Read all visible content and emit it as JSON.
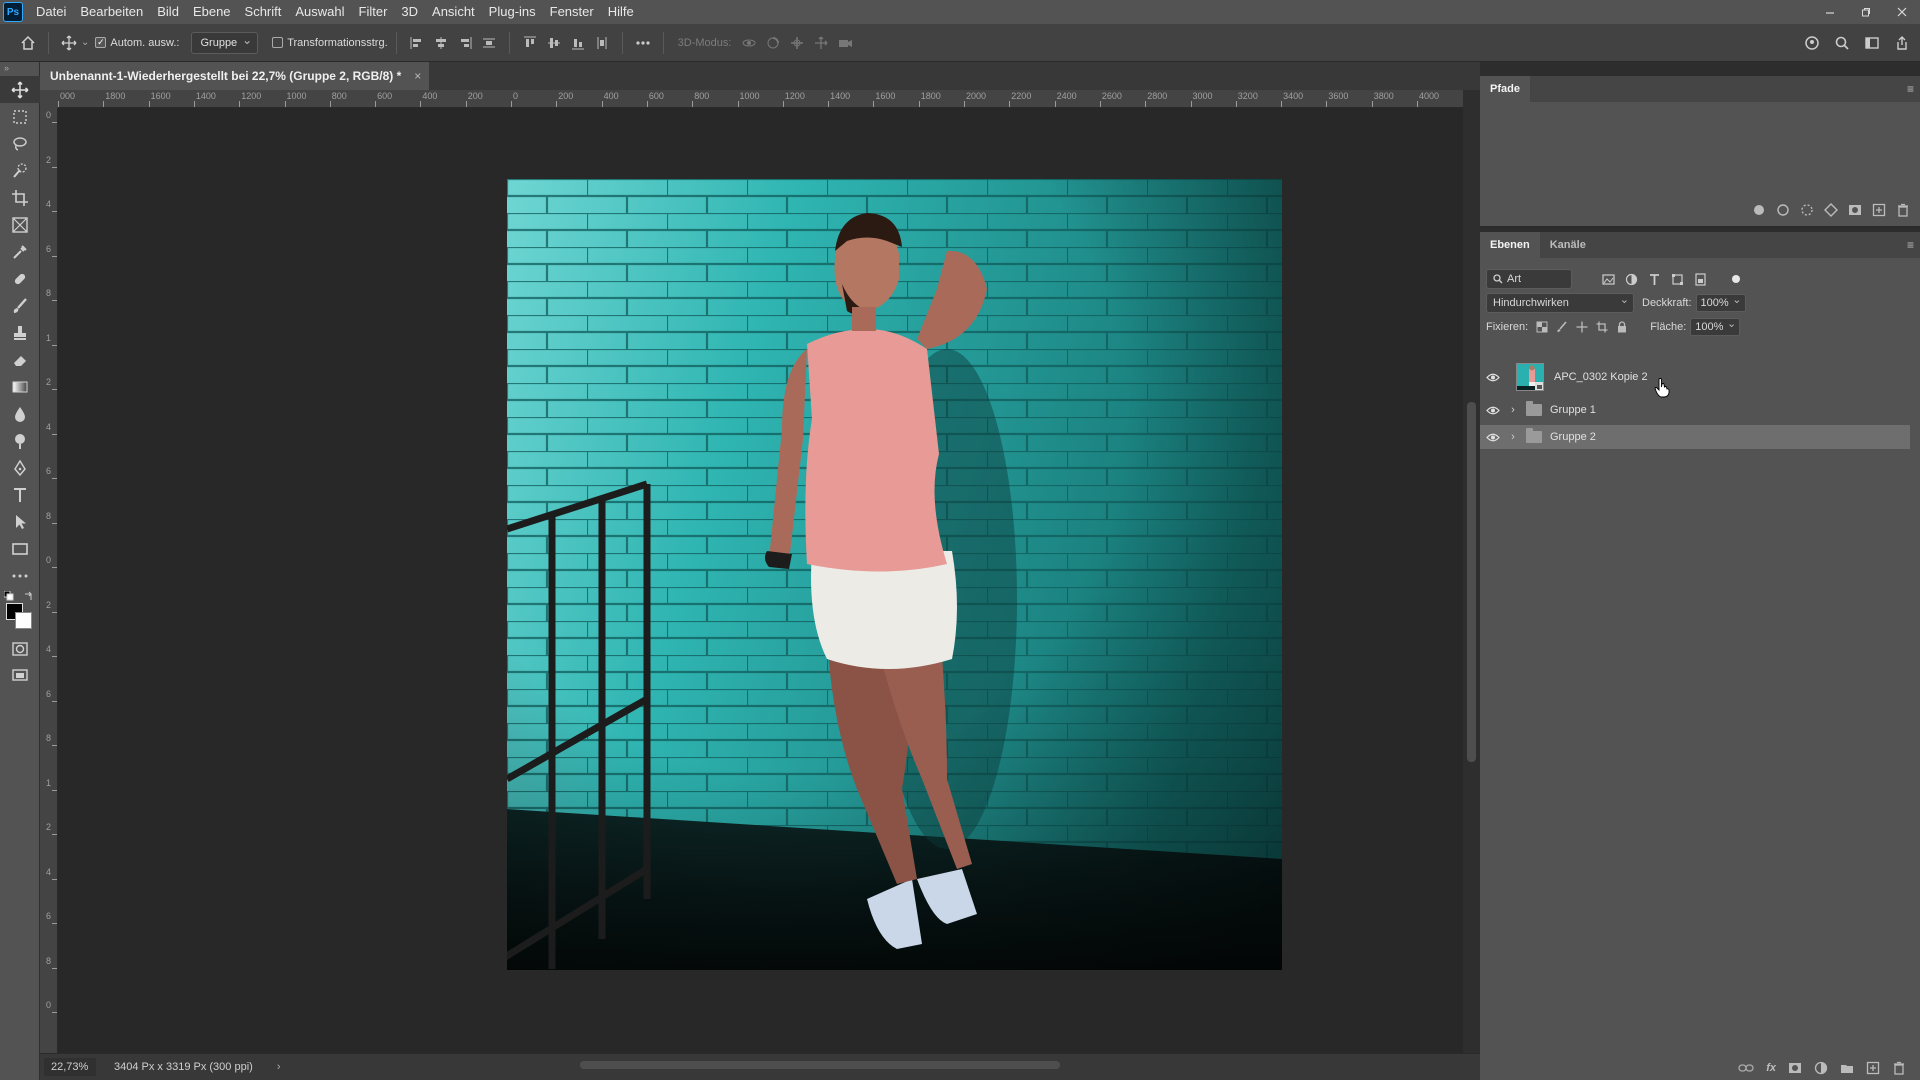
{
  "menubar": {
    "logo": "Ps",
    "items": [
      "Datei",
      "Bearbeiten",
      "Bild",
      "Ebene",
      "Schrift",
      "Auswahl",
      "Filter",
      "3D",
      "Ansicht",
      "Plug-ins",
      "Fenster",
      "Hilfe"
    ]
  },
  "options": {
    "auto_select_label": "Autom. ausw.:",
    "auto_select_target": "Gruppe",
    "transform_controls_label": "Transformationsstrg.",
    "mode_3d_label": "3D-Modus:"
  },
  "document": {
    "tab_title": "Unbenannt-1-Wiederhergestellt bei 22,7% (Gruppe 2, RGB/8) *",
    "close_glyph": "×"
  },
  "ruler": {
    "h_ticks": [
      "000",
      "1800",
      "1600",
      "1400",
      "1200",
      "1000",
      "800",
      "600",
      "400",
      "200",
      "0",
      "200",
      "400",
      "600",
      "800",
      "1000",
      "1200",
      "1400",
      "1600",
      "1800",
      "2000",
      "2200",
      "2400",
      "2600",
      "2800",
      "3000",
      "3200",
      "3400",
      "3600",
      "3800",
      "4000"
    ],
    "v_ticks": [
      "0",
      "2",
      "4",
      "6",
      "8",
      "1",
      "2",
      "4",
      "6",
      "8",
      "0",
      "2",
      "4",
      "6",
      "8",
      "1",
      "2",
      "4",
      "6",
      "8",
      "0"
    ]
  },
  "status": {
    "zoom": "22,73%",
    "doc_size": "3404 Px x 3319 Px (300 ppi)",
    "arrow": "›"
  },
  "paths_panel": {
    "tab": "Pfade"
  },
  "layers_panel": {
    "tabs": [
      "Ebenen",
      "Kanäle"
    ],
    "filter_kind": "Art",
    "blend_mode": "Hindurchwirken",
    "opacity_label": "Deckkraft:",
    "opacity_value": "100%",
    "lock_label": "Fixieren:",
    "fill_label": "Fläche:",
    "fill_value": "100%",
    "layers": [
      {
        "name": "APC_0302 Kopie 2",
        "type": "smart-object",
        "visible": true,
        "selected": false
      },
      {
        "name": "Gruppe 1",
        "type": "group",
        "visible": true,
        "selected": false
      },
      {
        "name": "Gruppe 2",
        "type": "group",
        "visible": true,
        "selected": true
      }
    ]
  },
  "colors": {
    "accent": "#31a8ff",
    "panel": "#535353",
    "canvas": "#282828",
    "wall": "#2ab3b3"
  }
}
